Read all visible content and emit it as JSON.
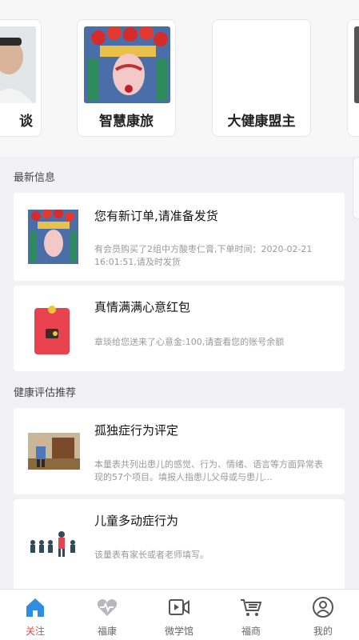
{
  "carousel": {
    "cards": [
      {
        "label": "谈"
      },
      {
        "label": "智慧康旅"
      },
      {
        "label": "大健康盟主"
      },
      {
        "label": ""
      }
    ]
  },
  "latest": {
    "title": "最新信息",
    "items": [
      {
        "title": "您有新订单,请准备发货",
        "desc": "有会员购买了2组中方酸枣仁膏,下单时间：2020-02-21 16:01:51,请及时发货"
      },
      {
        "title": "真情满满心意红包",
        "desc": "章琰给您送来了心意金:100,请查看您的账号余额"
      }
    ]
  },
  "recommend": {
    "title": "健康评估推荐",
    "items": [
      {
        "title": "孤独症行为评定",
        "desc": "本量表共列出患儿的感觉、行为、情绪、语言等方面异常表现的57个项目。填报人指患儿父母或与患儿..."
      },
      {
        "title": "儿童多动症行为",
        "desc": "该量表有家长或者老师填写。"
      }
    ]
  },
  "tabs": [
    {
      "label": "关注",
      "icon": "home-icon",
      "active": true
    },
    {
      "label": "福康",
      "icon": "heart-icon",
      "active": false
    },
    {
      "label": "微学馆",
      "icon": "video-icon",
      "active": false
    },
    {
      "label": "福商",
      "icon": "cart-icon",
      "active": false
    },
    {
      "label": "我的",
      "icon": "user-icon",
      "active": false
    }
  ],
  "colors": {
    "accent": "#e8483c",
    "tab_active_icon": "#2f8ee0",
    "envelope": "#e8424f"
  }
}
